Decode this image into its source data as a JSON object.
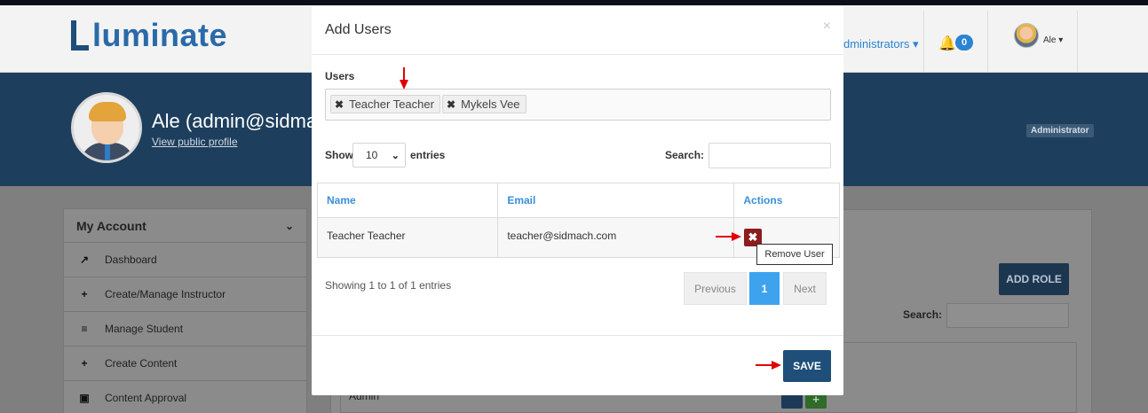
{
  "app": {
    "logo_text": "luminate",
    "nav_admin_label": "dministrators",
    "notification_count": "0",
    "nav_user": "Ale"
  },
  "profile": {
    "name": "Ale (admin@sidmac",
    "link": "View public profile",
    "role_badge": "Administrator"
  },
  "sidebar": {
    "title": "My Account",
    "items": [
      {
        "icon": "chart-icon",
        "label": "Dashboard"
      },
      {
        "icon": "plus-icon",
        "label": "Create/Manage Instructor"
      },
      {
        "icon": "list-icon",
        "label": "Manage Student"
      },
      {
        "icon": "plus-icon",
        "label": "Create Content"
      },
      {
        "icon": "clipboard-icon",
        "label": "Content Approval"
      }
    ]
  },
  "page": {
    "add_role": "ADD ROLE",
    "search_label": "Search:",
    "row_text": "Admin"
  },
  "modal": {
    "title": "Add Users",
    "close": "×",
    "users_label": "Users",
    "selected_users": [
      "Teacher Teacher",
      "Mykels Vee"
    ],
    "show_label": "Show",
    "entries_value": "10",
    "entries_label": "entries",
    "search_label": "Search:",
    "search_value": "",
    "table": {
      "headers": [
        "Name",
        "Email",
        "Actions"
      ],
      "rows": [
        {
          "name": "Teacher Teacher",
          "email": "teacher@sidmach.com"
        }
      ]
    },
    "remove_tooltip": "Remove User",
    "showing": "Showing 1 to 1 of 1 entries",
    "pagination": {
      "previous": "Previous",
      "current": "1",
      "next": "Next"
    },
    "save": "SAVE"
  },
  "colors": {
    "primary": "#1f4e79",
    "link_blue": "#3a8fd9",
    "danger": "#8b1d1d",
    "annotation_arrow": "#e00000"
  }
}
